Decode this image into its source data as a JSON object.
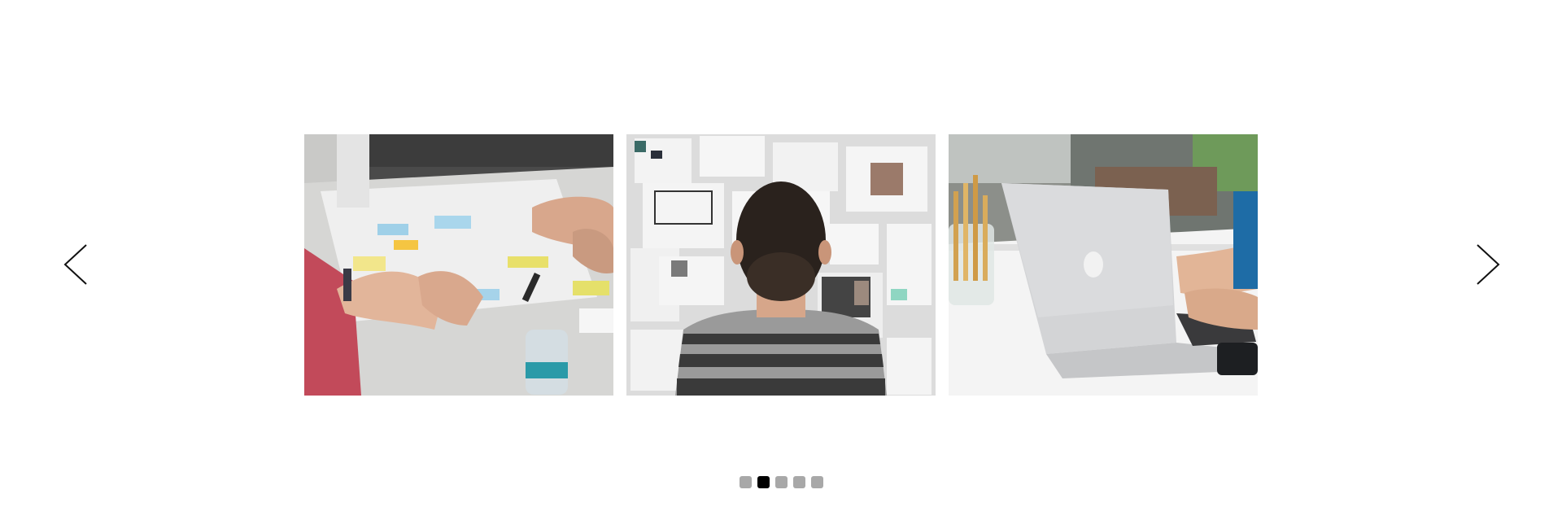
{
  "carousel": {
    "prev_icon": "chevron-left-icon",
    "next_icon": "chevron-right-icon",
    "slides": [
      {
        "subject": "team-meeting-sticky-notes-photo"
      },
      {
        "subject": "man-facing-moodboard-wall-photo"
      },
      {
        "subject": "laptop-on-desk-with-pencils-photo"
      }
    ],
    "dots": [
      {
        "active": false
      },
      {
        "active": true
      },
      {
        "active": false
      },
      {
        "active": false
      },
      {
        "active": false
      }
    ],
    "colors": {
      "dot_inactive": "#a8a8a8",
      "dot_active": "#000000",
      "arrow": "#111111",
      "background": "#ffffff"
    }
  }
}
